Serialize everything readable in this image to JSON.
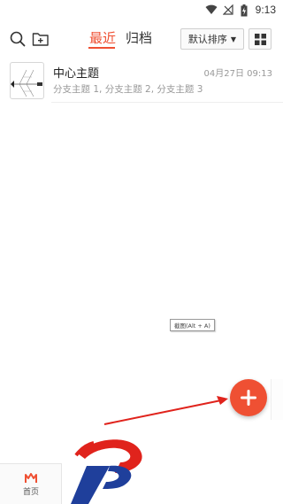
{
  "status_bar": {
    "time": "9:13"
  },
  "header": {
    "tabs": [
      {
        "label": "最近",
        "active": true
      },
      {
        "label": "归档",
        "active": false
      }
    ],
    "sort_label": "默认排序"
  },
  "files": [
    {
      "title": "中心主题",
      "date": "04月27日 09:13",
      "subtitle": "分支主题 1, 分支主题 2, 分支主题 3"
    }
  ],
  "tooltip": "截图(Alt + A)",
  "bottom_nav": {
    "home_label": "首页"
  },
  "colors": {
    "accent": "#ef5033",
    "arrow": "#e0231c",
    "logo_blue": "#1f3f9b"
  },
  "icons": [
    "wifi-icon",
    "no-signal-icon",
    "battery-charging-icon",
    "search-icon",
    "new-folder-icon",
    "chevron-down-icon",
    "grid-view-icon",
    "plus-icon",
    "home-icon"
  ]
}
